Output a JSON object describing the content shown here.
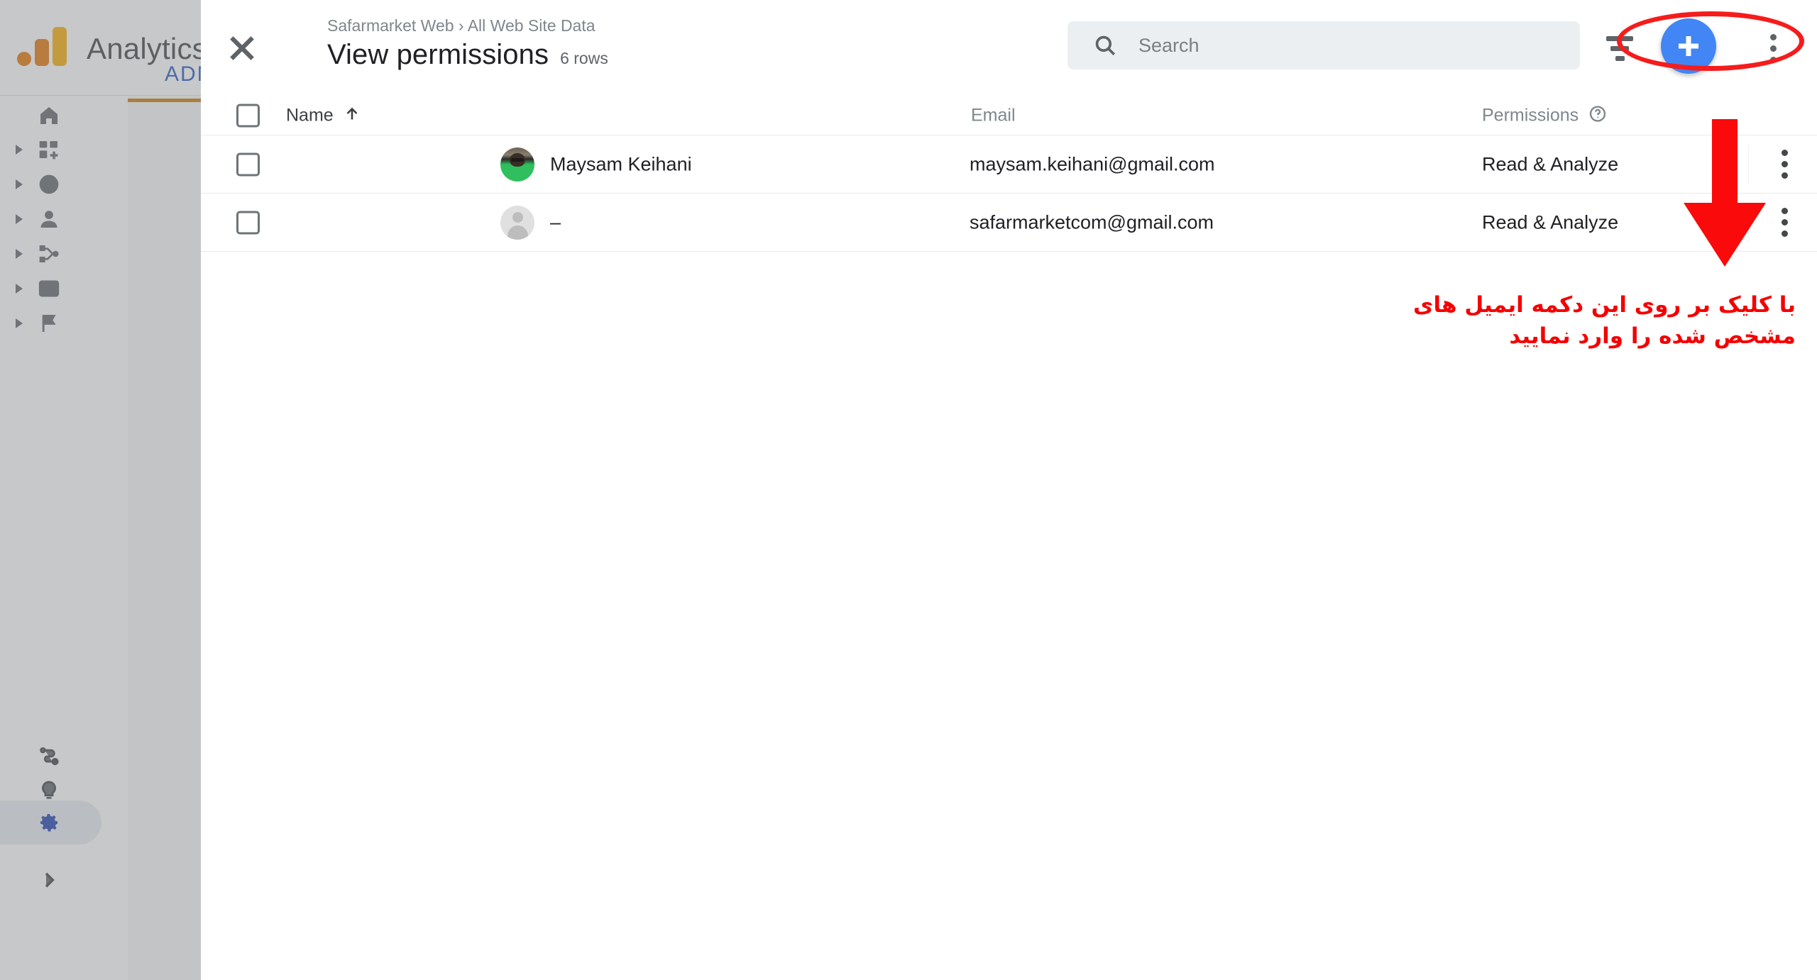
{
  "background_app": {
    "brand": "Analytics",
    "logo_icon": "google-analytics-logo",
    "accent_color": "#E37400",
    "tab_label": "ADMIN",
    "tab_color": "#1a56c4",
    "tab_underline_color": "#C77700",
    "nav_items": [
      {
        "icon": "home-icon",
        "has_caret": false
      },
      {
        "icon": "customization-add-icon",
        "has_caret": true
      },
      {
        "icon": "realtime-clock-icon",
        "has_caret": true
      },
      {
        "icon": "audience-person-icon",
        "has_caret": true
      },
      {
        "icon": "acquisition-share-icon",
        "has_caret": true
      },
      {
        "icon": "behavior-layout-icon",
        "has_caret": true
      },
      {
        "icon": "conversions-flag-icon",
        "has_caret": true
      }
    ],
    "bottom_items": [
      {
        "icon": "attribution-path-icon",
        "active": false
      },
      {
        "icon": "discover-lightbulb-icon",
        "active": false
      },
      {
        "icon": "admin-gear-icon",
        "active": true,
        "color": "#1a3bb0"
      },
      {
        "icon": "expand-chevron-right-icon",
        "active": false
      }
    ]
  },
  "panel": {
    "close_icon": "close-icon",
    "breadcrumb": "Safarmarket Web › All Web Site Data",
    "title": "View permissions",
    "row_count": "6 rows",
    "search": {
      "icon": "search-icon",
      "placeholder": "Search",
      "value": ""
    },
    "actions": {
      "filter_icon": "filter-icon",
      "add_icon": "plus-icon",
      "add_color": "#4285F4",
      "more_icon": "kebab-menu-icon"
    },
    "table": {
      "columns": [
        {
          "key": "name",
          "label": "Name",
          "sort": "ascending",
          "sort_icon": "arrow-up-icon"
        },
        {
          "key": "email",
          "label": "Email"
        },
        {
          "key": "permissions",
          "label": "Permissions",
          "help_icon": "help-circle-icon"
        }
      ],
      "rows": [
        {
          "checked": false,
          "avatar": "user-photo-avatar",
          "name": "Maysam Keihani",
          "email": "maysam.keihani@gmail.com",
          "permissions": "Read & Analyze",
          "row_menu_icon": "kebab-menu-icon"
        },
        {
          "checked": false,
          "avatar": "default-person-avatar",
          "name": "–",
          "email": "safarmarketcom@gmail.com",
          "permissions": "Read & Analyze",
          "row_menu_icon": "kebab-menu-icon"
        }
      ]
    }
  },
  "annotations": {
    "color": "#f50000",
    "ellipse_target": "top-right-action-buttons",
    "arrow_icon": "red-down-arrow",
    "note_line1": "با کلیک بر روی این دکمه ایمیل های",
    "note_line2": "مشخص شده را وارد نمایید"
  }
}
